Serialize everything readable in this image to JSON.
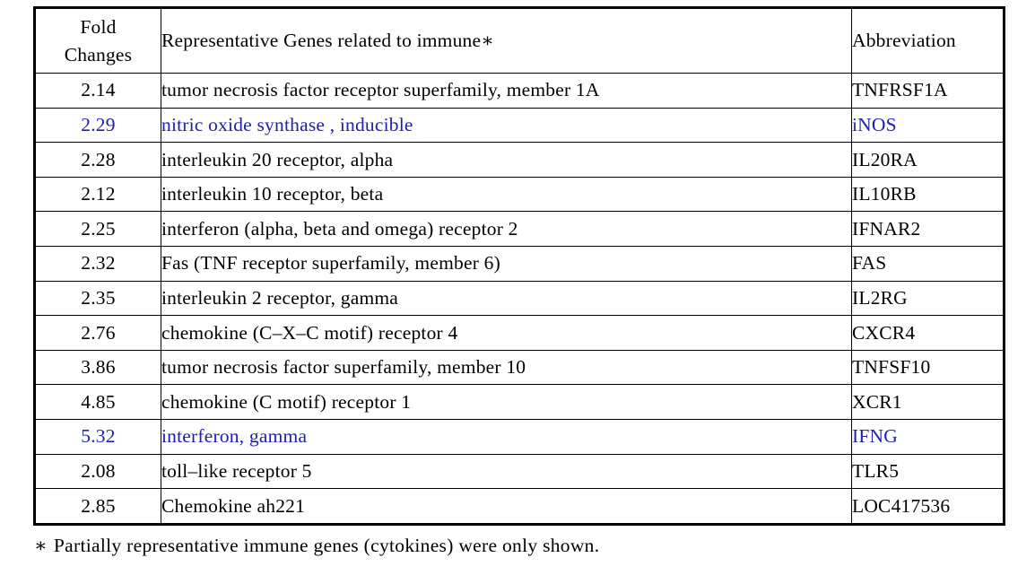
{
  "table": {
    "columns": [
      {
        "key": "fold",
        "label_line1": "Fold",
        "label_line2": "Changes"
      },
      {
        "key": "gene",
        "label": "Representative Genes related to immune∗"
      },
      {
        "key": "abbr",
        "label": "Abbreviation"
      }
    ],
    "highlight_color": "#2020b0",
    "text_color": "#000000",
    "border_color": "#000000",
    "rows": [
      {
        "fold": "2.14",
        "gene": "tumor necrosis factor receptor superfamily, member 1A",
        "abbr": "TNFRSF1A",
        "highlighted": false
      },
      {
        "fold": "2.29",
        "gene": "nitric oxide synthase , inducible",
        "abbr": "iNOS",
        "highlighted": true
      },
      {
        "fold": "2.28",
        "gene": "interleukin 20 receptor, alpha",
        "abbr": "IL20RA",
        "highlighted": false
      },
      {
        "fold": "2.12",
        "gene": "interleukin 10 receptor, beta",
        "abbr": "IL10RB",
        "highlighted": false
      },
      {
        "fold": "2.25",
        "gene": "interferon (alpha, beta and omega) receptor 2",
        "abbr": "IFNAR2",
        "highlighted": false
      },
      {
        "fold": "2.32",
        "gene": "Fas (TNF receptor superfamily, member 6)",
        "abbr": "FAS",
        "highlighted": false
      },
      {
        "fold": "2.35",
        "gene": "interleukin 2 receptor, gamma",
        "abbr": "IL2RG",
        "highlighted": false
      },
      {
        "fold": "2.76",
        "gene": "chemokine (C–X–C motif) receptor 4",
        "abbr": "CXCR4",
        "highlighted": false
      },
      {
        "fold": "3.86",
        "gene": "tumor necrosis factor superfamily, member 10",
        "abbr": "TNFSF10",
        "highlighted": false
      },
      {
        "fold": "4.85",
        "gene": "chemokine (C motif) receptor 1",
        "abbr": "XCR1",
        "highlighted": false
      },
      {
        "fold": "5.32",
        "gene": "interferon, gamma",
        "abbr": "IFNG",
        "highlighted": true
      },
      {
        "fold": "2.08",
        "gene": "toll–like receptor 5",
        "abbr": "TLR5",
        "highlighted": false
      },
      {
        "fold": "2.85",
        "gene": "Chemokine ah221",
        "abbr": "LOC417536",
        "highlighted": false
      }
    ]
  },
  "footnote": {
    "marker": "∗",
    "text": "Partially  representative  immune  genes  (cytokines)  were  only  shown."
  }
}
